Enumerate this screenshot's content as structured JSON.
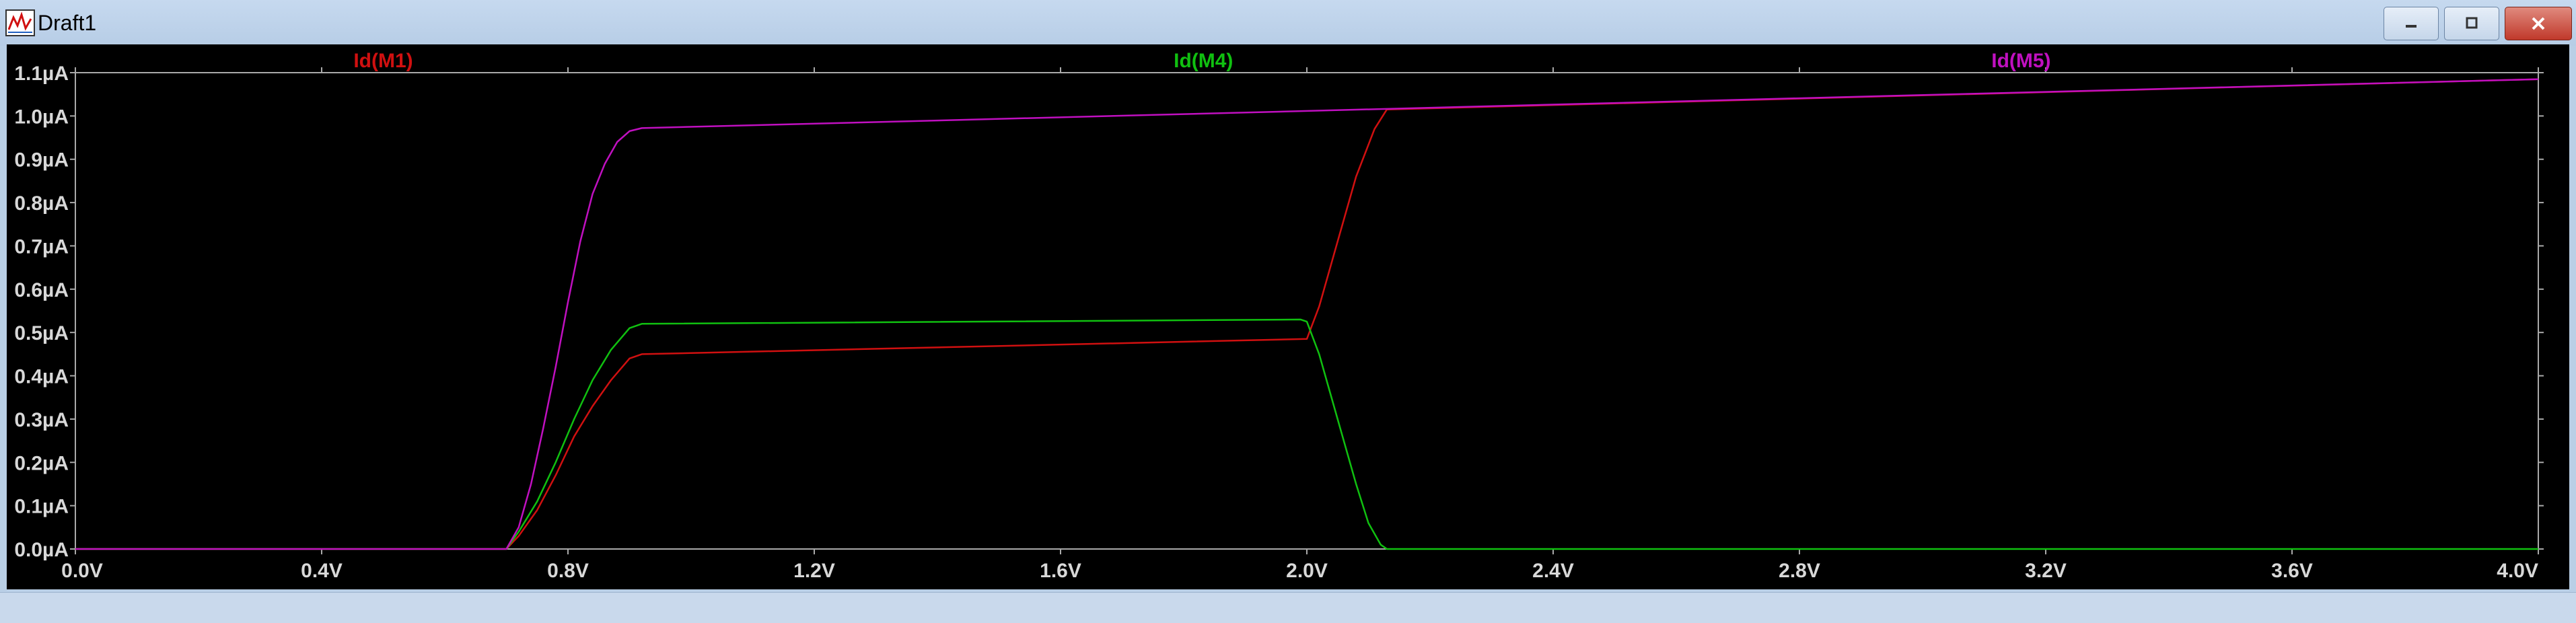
{
  "window": {
    "title": "Draft1",
    "icons": {
      "app": "waveform-viewer-icon",
      "minimize": "minimize-icon",
      "maximize": "maximize-icon",
      "close": "close-icon"
    },
    "colors": {
      "close_button": "#c0392b"
    }
  },
  "chart_data": {
    "type": "line",
    "background": "#000000",
    "axis_color": "#aaaaaa",
    "tick_label_color": "#d8d8d8",
    "grid": false,
    "legend": "top (labels above plot)",
    "xlim": [
      0.0,
      4.0
    ],
    "ylim": [
      0.0,
      1.1
    ],
    "x_ticks": [
      {
        "value": 0.0,
        "label": "0.0V"
      },
      {
        "value": 0.4,
        "label": "0.4V"
      },
      {
        "value": 0.8,
        "label": "0.8V"
      },
      {
        "value": 1.2,
        "label": "1.2V"
      },
      {
        "value": 1.6,
        "label": "1.6V"
      },
      {
        "value": 2.0,
        "label": "2.0V"
      },
      {
        "value": 2.4,
        "label": "2.4V"
      },
      {
        "value": 2.8,
        "label": "2.8V"
      },
      {
        "value": 3.2,
        "label": "3.2V"
      },
      {
        "value": 3.6,
        "label": "3.6V"
      },
      {
        "value": 4.0,
        "label": "4.0V"
      }
    ],
    "y_ticks": [
      {
        "value": 0.0,
        "label": "0.0µA"
      },
      {
        "value": 0.1,
        "label": "0.1µA"
      },
      {
        "value": 0.2,
        "label": "0.2µA"
      },
      {
        "value": 0.3,
        "label": "0.3µA"
      },
      {
        "value": 0.4,
        "label": "0.4µA"
      },
      {
        "value": 0.5,
        "label": "0.5µA"
      },
      {
        "value": 0.6,
        "label": "0.6µA"
      },
      {
        "value": 0.7,
        "label": "0.7µA"
      },
      {
        "value": 0.8,
        "label": "0.8µA"
      },
      {
        "value": 0.9,
        "label": "0.9µA"
      },
      {
        "value": 1.0,
        "label": "1.0µA"
      },
      {
        "value": 1.1,
        "label": "1.1µA"
      }
    ],
    "series": [
      {
        "name": "Id(M1)",
        "color": "#d01010",
        "x": [
          0.0,
          0.7,
          0.72,
          0.75,
          0.78,
          0.81,
          0.84,
          0.87,
          0.9,
          0.92,
          2.0,
          2.02,
          2.05,
          2.08,
          2.11,
          2.13,
          4.0
        ],
        "y": [
          0.0,
          0.0,
          0.03,
          0.09,
          0.17,
          0.26,
          0.33,
          0.39,
          0.44,
          0.45,
          0.485,
          0.56,
          0.71,
          0.86,
          0.97,
          1.015,
          1.085
        ]
      },
      {
        "name": "Id(M4)",
        "color": "#10c010",
        "x": [
          0.0,
          0.7,
          0.72,
          0.75,
          0.78,
          0.81,
          0.84,
          0.87,
          0.9,
          0.92,
          1.99,
          2.0,
          2.02,
          2.05,
          2.08,
          2.1,
          2.12,
          2.13,
          4.0
        ],
        "y": [
          0.0,
          0.0,
          0.04,
          0.11,
          0.2,
          0.3,
          0.39,
          0.46,
          0.51,
          0.52,
          0.53,
          0.525,
          0.45,
          0.3,
          0.15,
          0.06,
          0.01,
          0.0,
          0.0
        ]
      },
      {
        "name": "Id(M5)",
        "color": "#c010c0",
        "x": [
          0.0,
          0.7,
          0.72,
          0.74,
          0.76,
          0.78,
          0.8,
          0.82,
          0.84,
          0.86,
          0.88,
          0.9,
          0.92,
          4.0
        ],
        "y": [
          0.0,
          0.0,
          0.05,
          0.15,
          0.28,
          0.42,
          0.57,
          0.71,
          0.82,
          0.89,
          0.94,
          0.965,
          0.972,
          1.085
        ]
      }
    ]
  }
}
